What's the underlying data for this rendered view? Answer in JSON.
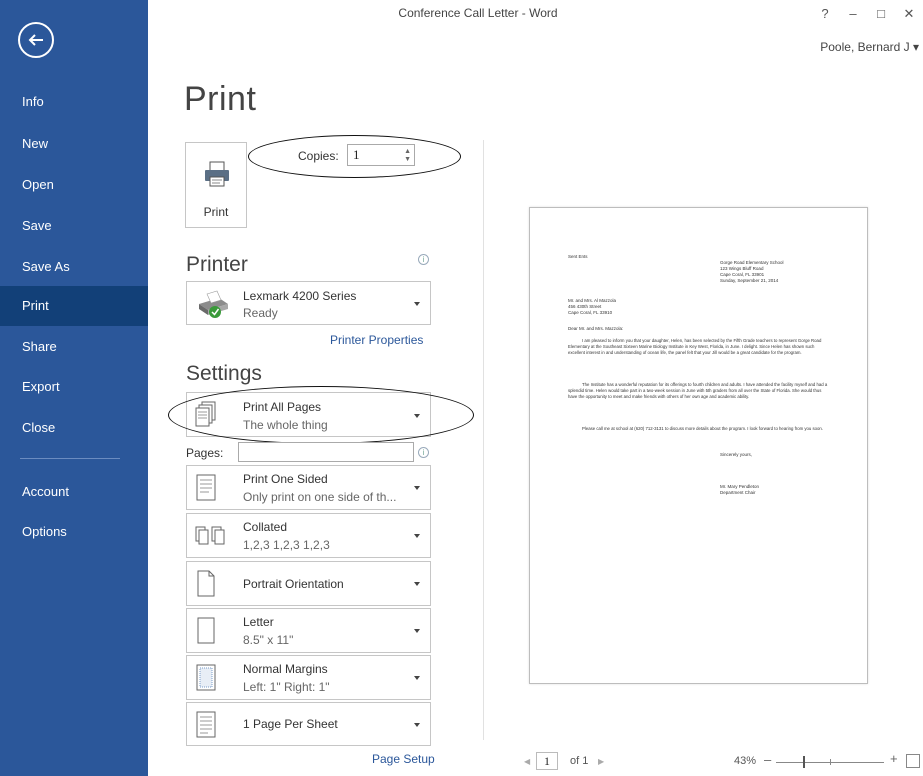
{
  "window": {
    "title": "Conference Call Letter - Word",
    "help": "?",
    "minimize": "–",
    "maximize": "□",
    "close": "✕",
    "user": "Poole, Bernard J ▾"
  },
  "sidebar": {
    "items": [
      {
        "label": "Info"
      },
      {
        "label": "New"
      },
      {
        "label": "Open"
      },
      {
        "label": "Save"
      },
      {
        "label": "Save As"
      },
      {
        "label": "Print",
        "active": true
      },
      {
        "label": "Share"
      },
      {
        "label": "Export"
      },
      {
        "label": "Close"
      },
      {
        "label": "Account"
      },
      {
        "label": "Options"
      }
    ]
  },
  "print": {
    "heading": "Print",
    "button_label": "Print",
    "copies_label": "Copies:",
    "copies_value": "1"
  },
  "printer": {
    "heading": "Printer",
    "name": "Lexmark 4200 Series",
    "status": "Ready",
    "properties_link": "Printer Properties"
  },
  "settings": {
    "heading": "Settings",
    "pages_label": "Pages:",
    "pages_value": "",
    "options": [
      {
        "line1": "Print All Pages",
        "line2": "The whole thing"
      },
      {
        "line1": "Print One Sided",
        "line2": "Only print on one side of th..."
      },
      {
        "line1": "Collated",
        "line2": "1,2,3   1,2,3   1,2,3"
      },
      {
        "line1": "Portrait Orientation",
        "line2": ""
      },
      {
        "line1": "Letter",
        "line2": "8.5\" x 11\""
      },
      {
        "line1": "Normal Margins",
        "line2": "Left: 1\"   Right: 1\""
      },
      {
        "line1": "1 Page Per Sheet",
        "line2": ""
      }
    ],
    "page_setup_link": "Page Setup"
  },
  "preview": {
    "salutation_top": "Sent Ents",
    "address_right": [
      "Gorge Road Elementary School",
      "123 Wings Bluff Road",
      "Cape Coral, FL 33901",
      "Sunday, September 21, 2014"
    ],
    "address_left": [
      "Mr. and Mrs. Al Mazzola",
      "456 430th Street",
      "Cape Coral, FL 33910"
    ],
    "greeting": "Dear Mr. and Mrs. Mazzola:",
    "para1": "I am pleased to inform you that your daughter, Helen, has been selected by the Fifth Grade teachers to represent Gorge Road Elementary at the Southeast Sixteen Marine Biology Institute in Key West, Florida, in June. I delight. Since Helen has shown such excellent interest in and understanding of ocean life, the panel felt that your Jill would be a great candidate for the program.",
    "para2": "The Institute has a wonderful reputation for its offerings to fourth children and adults. I have attended the facility myself and had a splendid time. Helen would take part in a two-week session in June with 5th graders from all over the State of Florida. She would thus have the opportunity to meet and make friends with others of her own age and academic ability.",
    "para3": "Please call me at school at (620) 712-3131 to discuss more details about the program. I look forward to hearing from you soon.",
    "closing": "Sincerely yours,",
    "sign_name": "Mr. Mary Pendleton",
    "sign_title": "Department Chair"
  },
  "bottom": {
    "prev": "◀",
    "page": "1",
    "of": "of 1",
    "next": "▶",
    "zoom": "43%",
    "minus": "–",
    "plus": "+"
  }
}
